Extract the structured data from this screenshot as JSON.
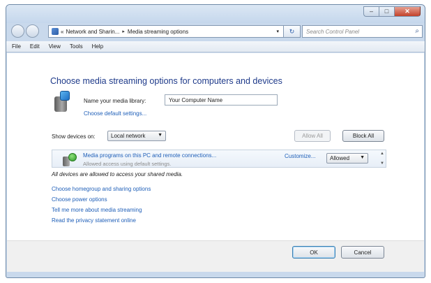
{
  "window": {
    "controls": {
      "minimize": "–",
      "maximize": "□",
      "close": "✕"
    }
  },
  "address_bar": {
    "back_icon": "back-arrow-icon",
    "forward_icon": "forward-arrow-icon",
    "prefix": "«",
    "crumbs": [
      "Network and Sharin...",
      "Media streaming options"
    ],
    "separator": "▸",
    "dropdown": "▾",
    "refresh": "↻",
    "search_placeholder": "Search Control Panel",
    "search_icon": "⌕"
  },
  "menu": [
    "File",
    "Edit",
    "View",
    "Tools",
    "Help"
  ],
  "main": {
    "title": "Choose media streaming options for computers and devices",
    "library_label": "Name your media library:",
    "library_value": "Your Computer Name",
    "default_settings_link": "Choose default settings...",
    "show_devices_label": "Show devices on:",
    "show_devices_value": "Local network",
    "allow_all": "Allow All",
    "block_all": "Block All",
    "device": {
      "title": "Media programs on this PC and remote connections...",
      "subtitle": "Allowed access using default settings.",
      "customize": "Customize...",
      "status": "Allowed"
    },
    "all_allowed_text": "All devices are allowed to access your shared media.",
    "links": [
      "Choose homegroup and sharing options",
      "Choose power options",
      "Tell me more about media streaming",
      "Read the privacy statement online"
    ]
  },
  "footer": {
    "ok": "OK",
    "cancel": "Cancel"
  }
}
